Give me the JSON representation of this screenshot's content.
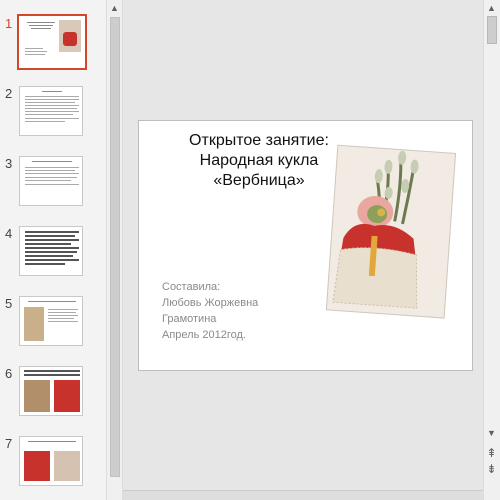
{
  "thumbnails": [
    {
      "number": "1",
      "selected": true
    },
    {
      "number": "2",
      "selected": false
    },
    {
      "number": "3",
      "selected": false
    },
    {
      "number": "4",
      "selected": false
    },
    {
      "number": "5",
      "selected": false
    },
    {
      "number": "6",
      "selected": false
    },
    {
      "number": "7",
      "selected": false
    }
  ],
  "slide": {
    "title_line1": "Открытое занятие:",
    "title_line2": "Народная кукла",
    "title_line3": "«Вербница»",
    "subtitle_line1": "Составила:",
    "subtitle_line2": "Любовь Жоржевна",
    "subtitle_line3": "Грамотина",
    "subtitle_line4": "Апрель 2012год."
  },
  "colors": {
    "selection": "#d24726",
    "doll_red": "#c8322d",
    "doll_pink": "#e9a7a0",
    "willow_green": "#8a9a6a"
  },
  "icons": {
    "scroll_up": "▲",
    "scroll_down": "▼",
    "prev_slide": "⇞",
    "next_slide": "⇟"
  }
}
